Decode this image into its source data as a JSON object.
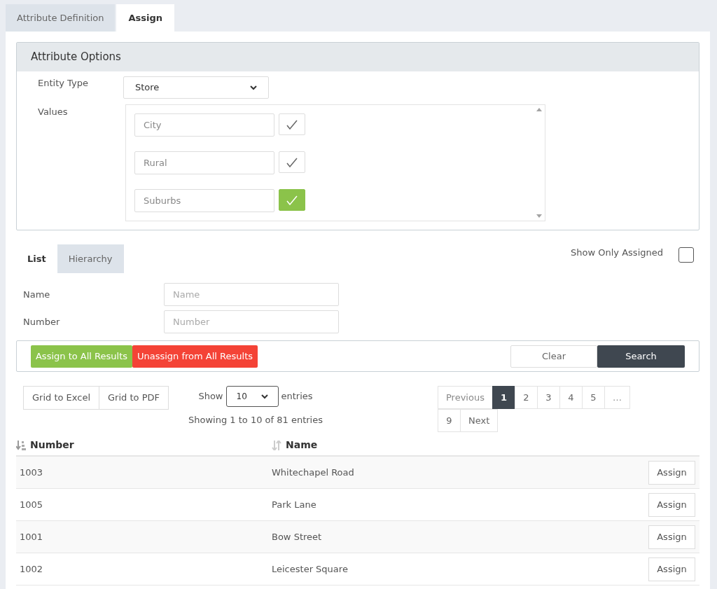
{
  "tabs": [
    {
      "label": "Attribute Definition",
      "selected": false
    },
    {
      "label": "Assign",
      "selected": true
    }
  ],
  "attribute_options": {
    "title": "Attribute Options",
    "entity_type": {
      "label": "Entity Type",
      "value": "Store"
    },
    "values": {
      "label": "Values",
      "items": [
        {
          "text": "City",
          "selected": false
        },
        {
          "text": "Rural",
          "selected": false
        },
        {
          "text": "Suburbs",
          "selected": true
        }
      ]
    }
  },
  "view_tabs": [
    {
      "label": "List",
      "selected": true
    },
    {
      "label": "Hierarchy",
      "selected": false
    }
  ],
  "show_only_assigned": {
    "label": "Show Only Assigned",
    "checked": false
  },
  "filters": [
    {
      "label": "Name",
      "placeholder": "Name"
    },
    {
      "label": "Number",
      "placeholder": "Number"
    }
  ],
  "actions": [
    {
      "label": "Assign to All Results",
      "kind": "assign"
    },
    {
      "label": "Unassign from All Results",
      "kind": "unassign"
    },
    {
      "label": "Clear",
      "kind": "clear"
    },
    {
      "label": "Search",
      "kind": "search"
    }
  ],
  "grid_exports": [
    "Grid to Excel",
    "Grid to PDF"
  ],
  "page_length": {
    "label_before": "Show",
    "value": "10",
    "label_after": "entries"
  },
  "info": "Showing 1 to 10 of 81 entries",
  "pagination": [
    {
      "label": "Previous",
      "selected": false,
      "disabled": true
    },
    {
      "label": "1",
      "selected": true,
      "disabled": false
    },
    {
      "label": "2",
      "selected": false,
      "disabled": false
    },
    {
      "label": "3",
      "selected": false,
      "disabled": false
    },
    {
      "label": "4",
      "selected": false,
      "disabled": false
    },
    {
      "label": "5",
      "selected": false,
      "disabled": false
    },
    {
      "label": "…",
      "selected": false,
      "disabled": true
    },
    {
      "label": "9",
      "selected": false,
      "disabled": false
    },
    {
      "label": "Next",
      "selected": false,
      "disabled": false
    }
  ],
  "table": {
    "columns": [
      {
        "label": "Number",
        "sorted": true
      },
      {
        "label": "Name",
        "sorted": false
      }
    ],
    "rows": [
      {
        "number": "1003",
        "name": "Whitechapel Road",
        "action": "Assign"
      },
      {
        "number": "1005",
        "name": "Park Lane",
        "action": "Assign"
      },
      {
        "number": "1001",
        "name": "Bow Street",
        "action": "Assign"
      },
      {
        "number": "1002",
        "name": "Leicester Square",
        "action": "Assign"
      }
    ]
  }
}
